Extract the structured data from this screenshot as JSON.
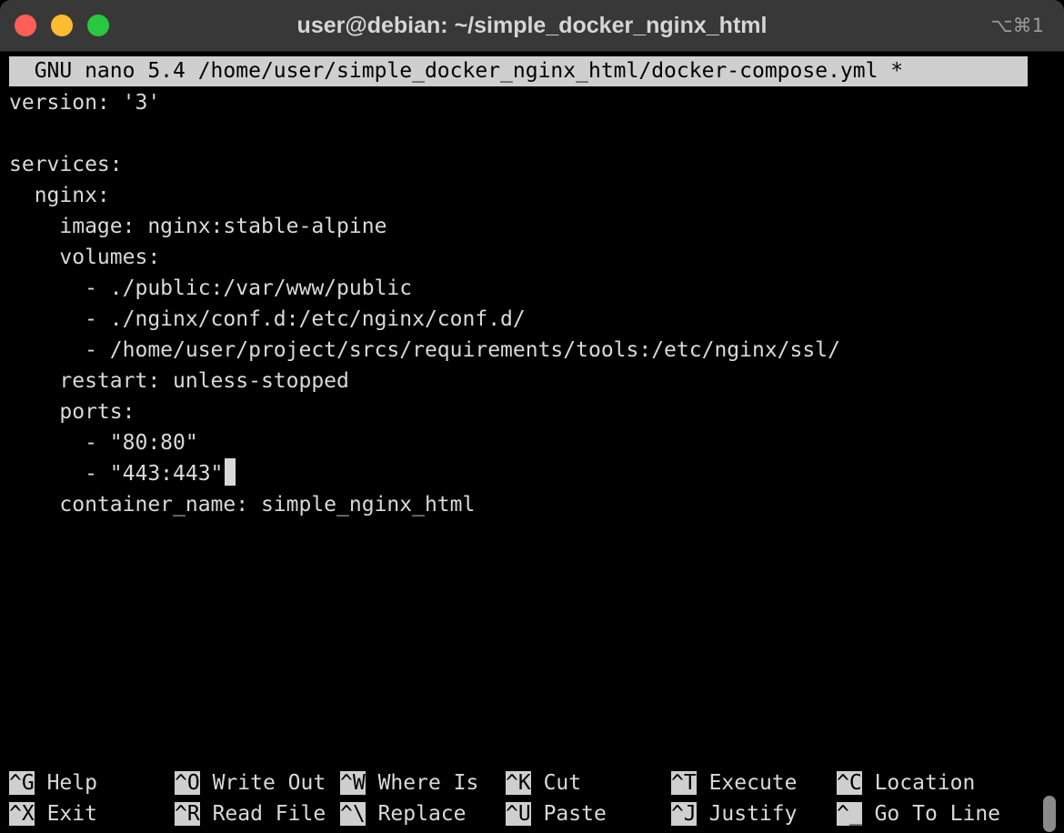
{
  "window": {
    "title": "user@debian: ~/simple_docker_nginx_html",
    "shortcut": "⌥⌘1"
  },
  "nano": {
    "header": "  GNU nano 5.4 /home/user/simple_docker_nginx_html/docker-compose.yml *",
    "lines": [
      "version: '3'",
      "",
      "services:",
      "  nginx:",
      "    image: nginx:stable-alpine",
      "    volumes:",
      "      - ./public:/var/www/public",
      "      - ./nginx/conf.d:/etc/nginx/conf.d/",
      "      - /home/user/project/srcs/requirements/tools:/etc/nginx/ssl/",
      "    restart: unless-stopped",
      "    ports:",
      "      - \"80:80\"",
      "      - \"443:443\"",
      "    container_name: simple_nginx_html"
    ],
    "shortcuts": {
      "help": {
        "key": "^G",
        "label": "Help"
      },
      "write": {
        "key": "^O",
        "label": "Write Out"
      },
      "where": {
        "key": "^W",
        "label": "Where Is"
      },
      "cut": {
        "key": "^K",
        "label": "Cut"
      },
      "execute": {
        "key": "^T",
        "label": "Execute"
      },
      "location": {
        "key": "^C",
        "label": "Location"
      },
      "exit": {
        "key": "^X",
        "label": "Exit"
      },
      "read": {
        "key": "^R",
        "label": "Read File"
      },
      "replace": {
        "key": "^\\",
        "label": "Replace"
      },
      "paste": {
        "key": "^U",
        "label": "Paste"
      },
      "justify": {
        "key": "^J",
        "label": "Justify"
      },
      "goto": {
        "key": "^_",
        "label": "Go To Line"
      }
    }
  },
  "colors": {
    "close": "#ff5f57",
    "minimize": "#febc2e",
    "maximize": "#28c840",
    "titlebar": "#383838",
    "terminal_bg": "#000000",
    "terminal_fg": "#d9d9d9",
    "highlight_bg": "#cfcfcf"
  }
}
